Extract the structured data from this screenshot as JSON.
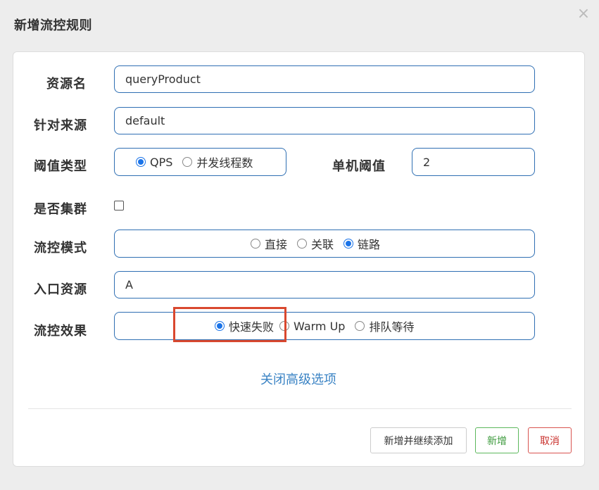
{
  "dialog": {
    "title": "新增流控规则",
    "close": "×"
  },
  "form": {
    "resource": {
      "label": "资源名",
      "value": "queryProduct"
    },
    "limit_app": {
      "label": "针对来源",
      "value": "default"
    },
    "grade": {
      "label": "阈值类型",
      "options": [
        {
          "label": "QPS",
          "checked": true
        },
        {
          "label": "并发线程数",
          "checked": false
        }
      ]
    },
    "count": {
      "label": "单机阈值",
      "value": "2"
    },
    "cluster": {
      "label": "是否集群",
      "checked": false
    },
    "strategy": {
      "label": "流控模式",
      "options": [
        {
          "label": "直接",
          "checked": false
        },
        {
          "label": "关联",
          "checked": false
        },
        {
          "label": "链路",
          "checked": true
        }
      ]
    },
    "ref_resource": {
      "label": "入口资源",
      "value": "A"
    },
    "control_behavior": {
      "label": "流控效果",
      "options": [
        {
          "label": "快速失败",
          "checked": true
        },
        {
          "label": "Warm Up",
          "checked": false
        },
        {
          "label": "排队等待",
          "checked": false
        }
      ]
    },
    "advanced_link": "关闭高级选项"
  },
  "footer": {
    "add_continue": "新增并继续添加",
    "add": "新增",
    "cancel": "取消"
  },
  "colors": {
    "accent": "#2f6fb3",
    "highlight": "#d9482f",
    "success": "#5cb85c",
    "danger": "#d9534f"
  }
}
